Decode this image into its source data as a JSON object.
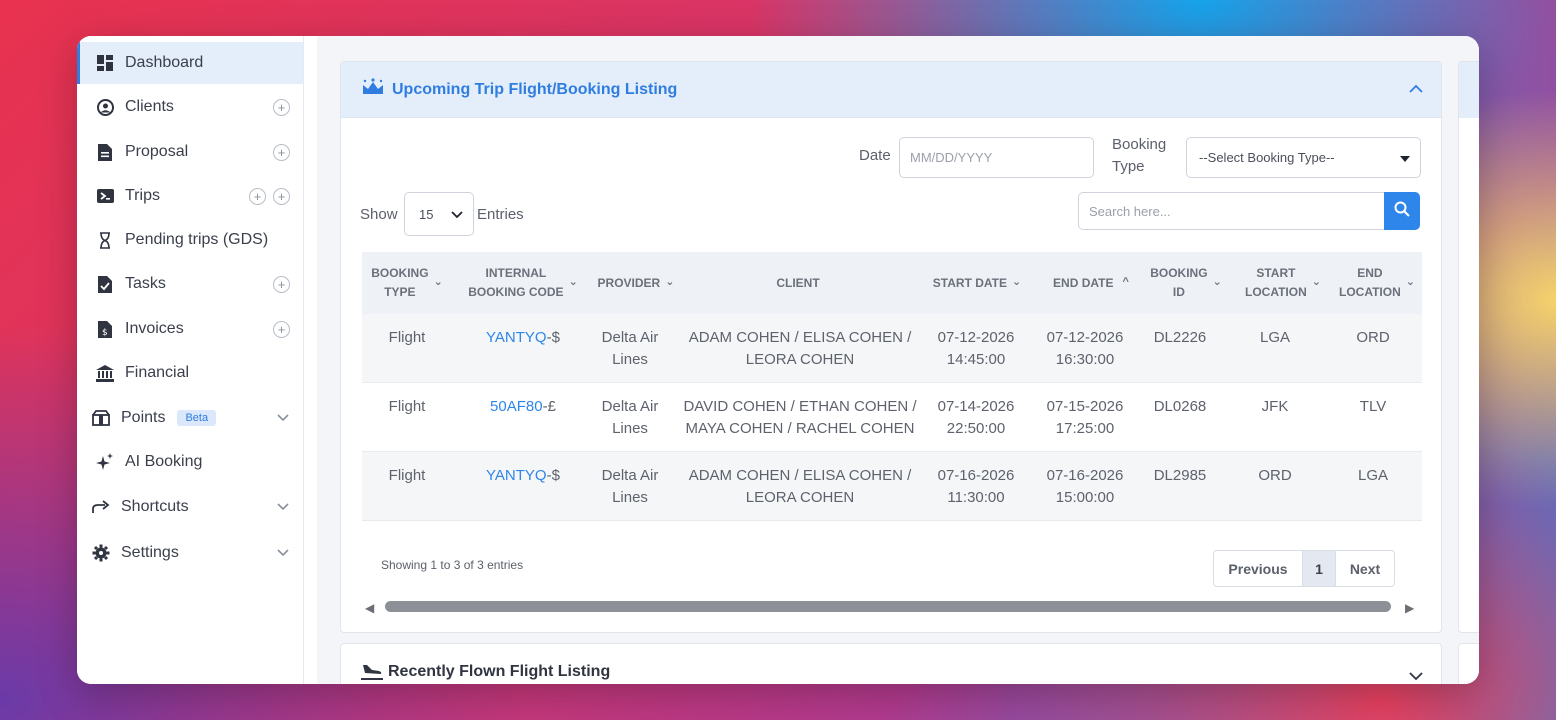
{
  "sidebar": {
    "items": [
      {
        "label": "Dashboard",
        "icon": "dashboard-icon"
      },
      {
        "label": "Clients",
        "icon": "clients-icon"
      },
      {
        "label": "Proposal",
        "icon": "proposal-icon"
      },
      {
        "label": "Trips",
        "icon": "trips-icon"
      },
      {
        "label": "Pending trips (GDS)",
        "icon": "hourglass-icon"
      },
      {
        "label": "Tasks",
        "icon": "tasks-icon"
      },
      {
        "label": "Invoices",
        "icon": "invoices-icon"
      },
      {
        "label": "Financial",
        "icon": "bank-icon"
      },
      {
        "label": "Points",
        "icon": "points-icon",
        "badge": "Beta"
      },
      {
        "label": "AI Booking",
        "icon": "sparkle-icon"
      },
      {
        "label": "Shortcuts",
        "icon": "share-arrow-icon"
      },
      {
        "label": "Settings",
        "icon": "gear-icon"
      }
    ]
  },
  "card": {
    "title": "Upcoming Trip Flight/Booking Listing",
    "filters": {
      "date_label": "Date",
      "date_placeholder": "MM/DD/YYYY",
      "booking_type_label_1": "Booking",
      "booking_type_label_2": "Type",
      "booking_type_value": "--Select Booking Type--"
    },
    "show_label": "Show",
    "entries_value": "15",
    "entries_label": "Entries",
    "search_placeholder": "Search here...",
    "columns": [
      {
        "l1": "BOOKING",
        "l2": "TYPE"
      },
      {
        "l1": "INTERNAL",
        "l2": "BOOKING CODE"
      },
      {
        "l1": "PROVIDER",
        "l2": ""
      },
      {
        "l1": "CLIENT",
        "l2": ""
      },
      {
        "l1": "START DATE",
        "l2": ""
      },
      {
        "l1": "END DATE",
        "l2": ""
      },
      {
        "l1": "BOOKING",
        "l2": "ID"
      },
      {
        "l1": "START",
        "l2": "LOCATION"
      },
      {
        "l1": "END",
        "l2": "LOCATION"
      }
    ],
    "rows": [
      {
        "type": "Flight",
        "code": "YANTYQ",
        "code_suffix": "-$",
        "provider_1": "Delta Air",
        "provider_2": "Lines",
        "client_1": "ADAM COHEN / ELISA COHEN /",
        "client_2": "LEORA COHEN",
        "start_1": "07-12-2026",
        "start_2": "14:45:00",
        "end_1": "07-12-2026",
        "end_2": "16:30:00",
        "booking_id": "DL2226",
        "start_loc": "LGA",
        "end_loc": "ORD"
      },
      {
        "type": "Flight",
        "code": "50AF80",
        "code_suffix": "-£",
        "provider_1": "Delta Air",
        "provider_2": "Lines",
        "client_1": "DAVID COHEN / ETHAN COHEN /",
        "client_2": "MAYA COHEN / RACHEL COHEN",
        "start_1": "07-14-2026",
        "start_2": "22:50:00",
        "end_1": "07-15-2026",
        "end_2": "17:25:00",
        "booking_id": "DL0268",
        "start_loc": "JFK",
        "end_loc": "TLV"
      },
      {
        "type": "Flight",
        "code": "YANTYQ",
        "code_suffix": "-$",
        "provider_1": "Delta Air",
        "provider_2": "Lines",
        "client_1": "ADAM COHEN / ELISA COHEN /",
        "client_2": "LEORA COHEN",
        "start_1": "07-16-2026",
        "start_2": "11:30:00",
        "end_1": "07-16-2026",
        "end_2": "15:00:00",
        "booking_id": "DL2985",
        "start_loc": "ORD",
        "end_loc": "LGA"
      }
    ],
    "info": "Showing 1 to 3 of 3 entries",
    "pager": {
      "previous": "Previous",
      "current": "1",
      "next": "Next"
    }
  },
  "card2": {
    "title": "Recently Flown Flight Listing"
  },
  "colors": {
    "accent": "#2f7de1",
    "active_bg": "#e4eefa"
  }
}
